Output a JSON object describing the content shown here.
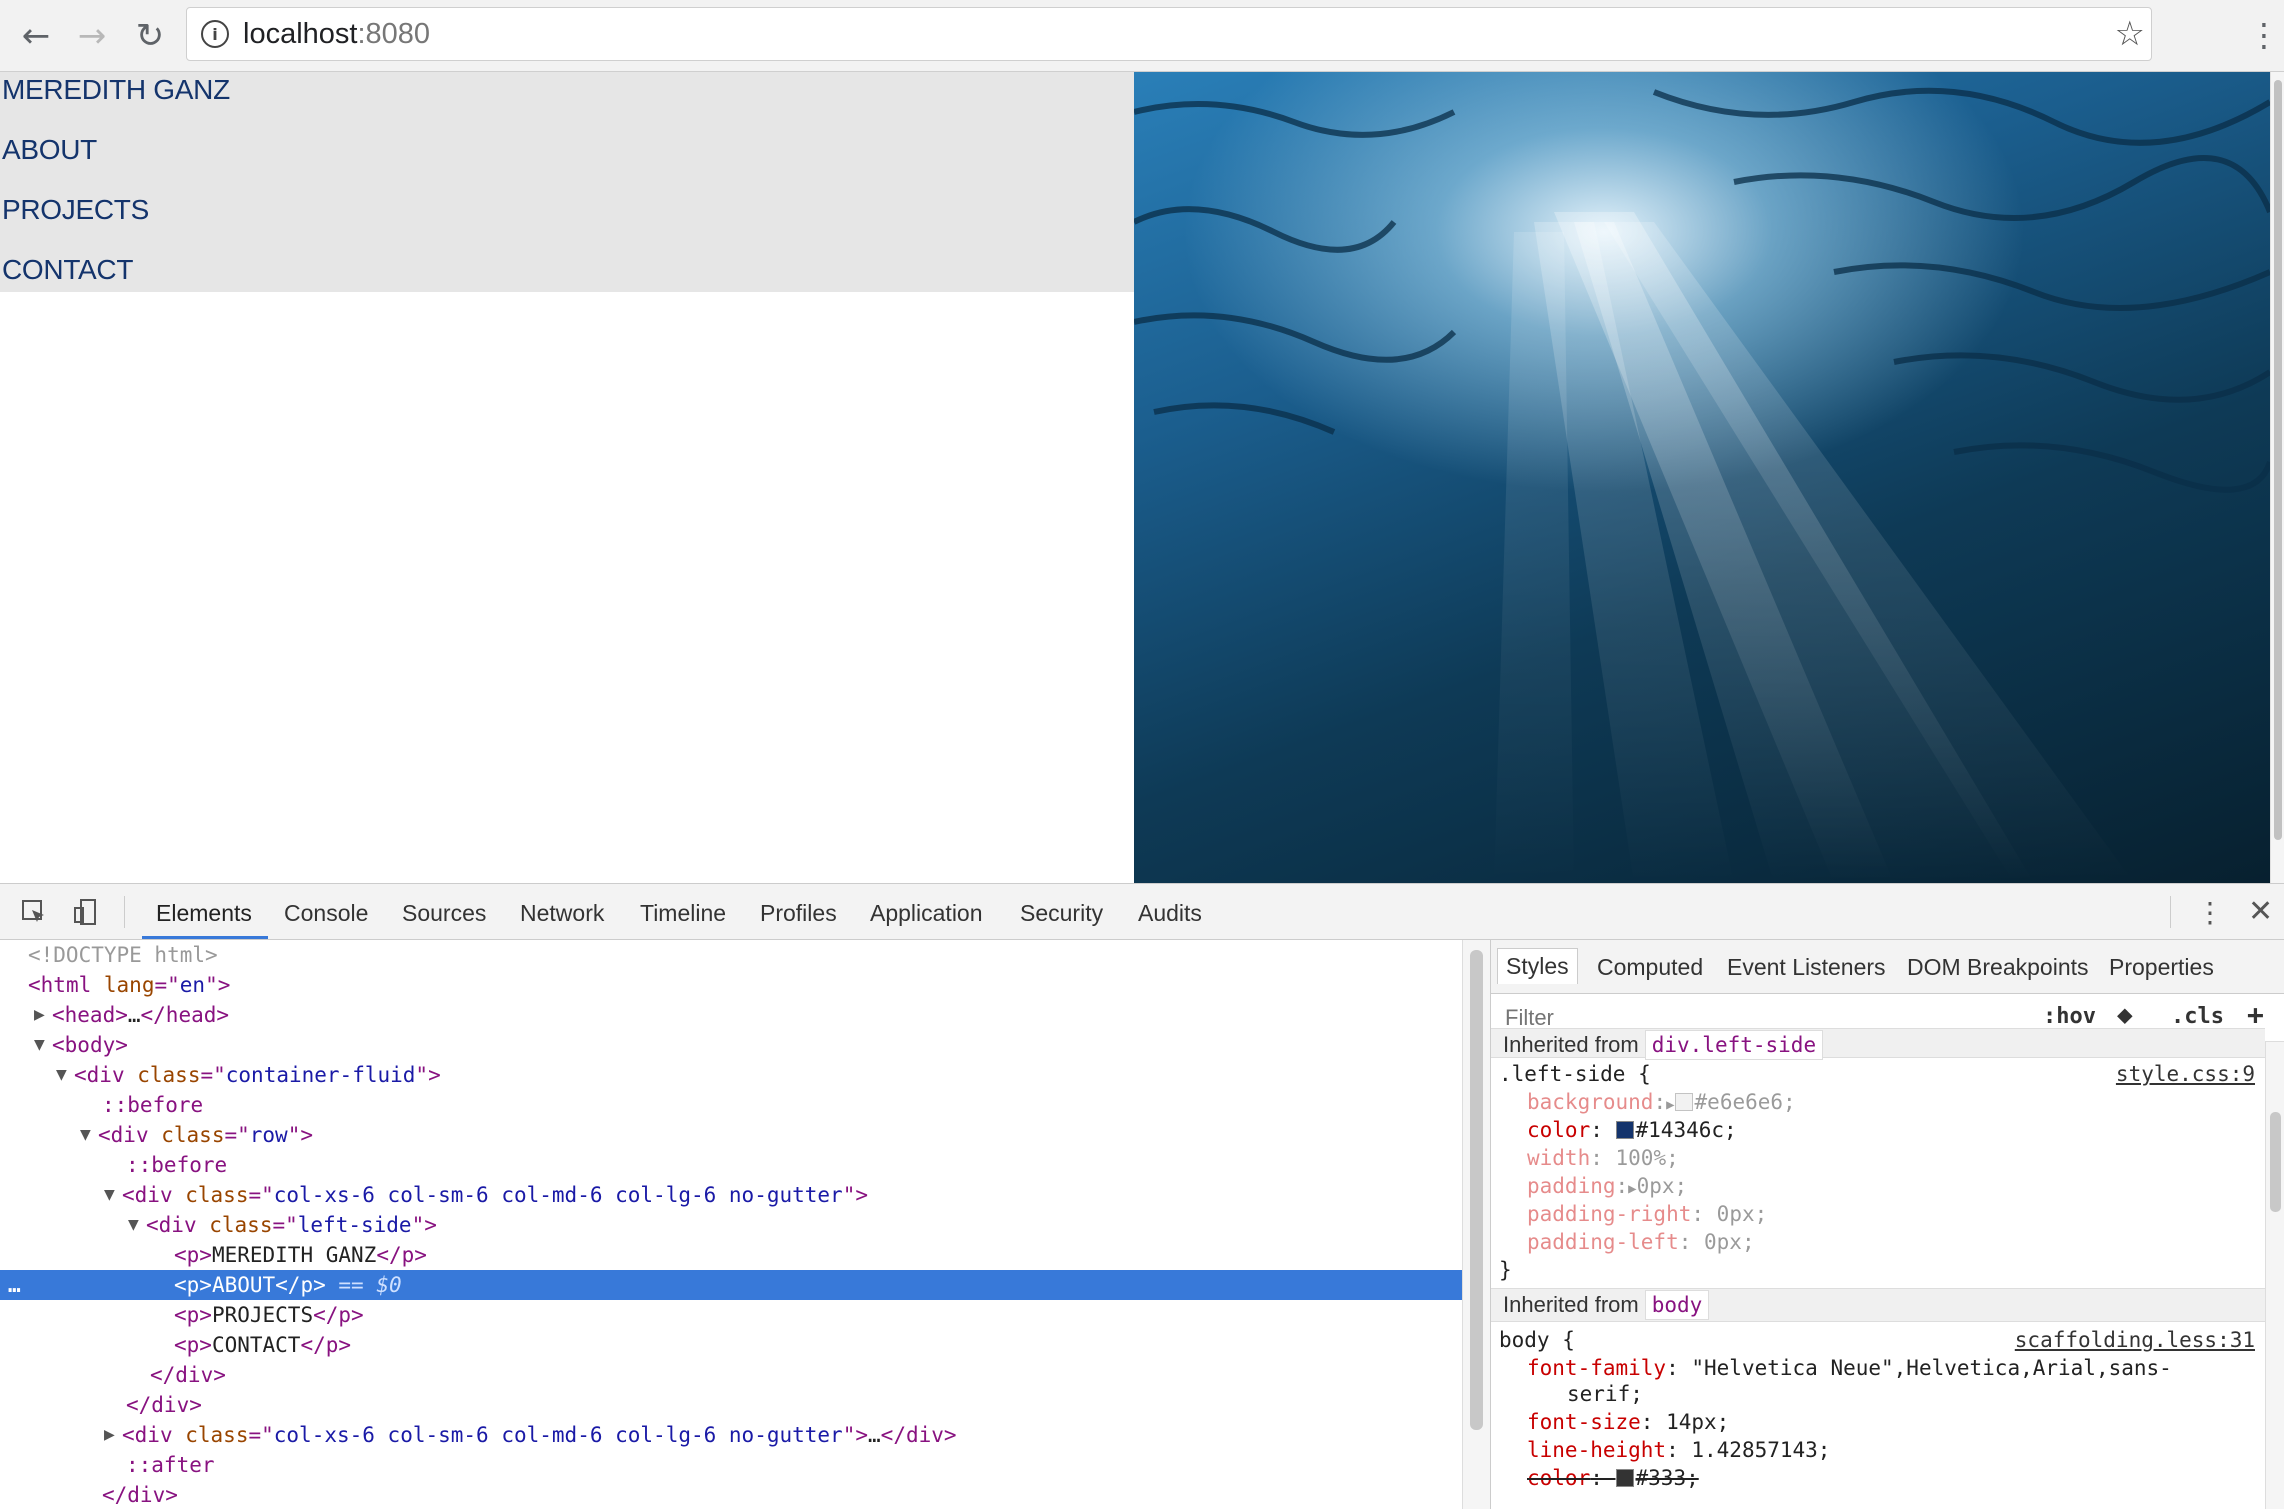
{
  "browser": {
    "url_host": "localhost",
    "url_port": ":8080",
    "icons": {
      "back": "back-arrow-icon",
      "forward": "forward-arrow-icon",
      "reload": "reload-icon",
      "info": "info-icon",
      "star": "star-icon",
      "menu": "kebab-menu-icon"
    }
  },
  "page": {
    "nav_items": [
      "MEREDITH GANZ",
      "ABOUT",
      "PROJECTS",
      "CONTACT"
    ],
    "left_background": "#e6e6e6",
    "link_color": "#14346c",
    "image_subject": "underwater sunlight rays"
  },
  "devtools": {
    "tabs": [
      "Elements",
      "Console",
      "Sources",
      "Network",
      "Timeline",
      "Profiles",
      "Application",
      "Security",
      "Audits"
    ],
    "active_tab": "Elements",
    "accent": "#3879d9",
    "dom": {
      "doctype": "<!DOCTYPE html>",
      "html_tag": "html",
      "lang_attr": "lang",
      "lang_val": "en",
      "head_collapsed": "…",
      "body": "body",
      "div": "div",
      "class_attr": "class",
      "container_class": "container-fluid",
      "row_class": "row",
      "col_class": "col-xs-6 col-sm-6 col-md-6 col-lg-6 no-gutter",
      "left_side_class": "left-side",
      "before": "::before",
      "after": "::after",
      "p_items": [
        "MEREDITH GANZ",
        "ABOUT",
        "PROJECTS",
        "CONTACT"
      ],
      "selected_marker": "== $0",
      "ellipsis": "…"
    },
    "styles_pane": {
      "tabs": [
        "Styles",
        "Computed",
        "Event Listeners",
        "DOM Breakpoints",
        "Properties"
      ],
      "filter_placeholder": "Filter",
      "hov": ":hov",
      "cls": ".cls",
      "plus": "+",
      "inherited_label": "Inherited from",
      "inherited_top_chip": "div.left-side",
      "rule1": {
        "selector": ".left-side {",
        "source": "style.css:9",
        "props": [
          {
            "name": "background",
            "value": "#e6e6e6",
            "active": false,
            "swatch": "#e6e6e6",
            "expand": true
          },
          {
            "name": "color",
            "value": "#14346c;",
            "active": true,
            "swatch": "#14346c",
            "expand": false
          },
          {
            "name": "width",
            "value": "100%;",
            "active": false
          },
          {
            "name": "padding",
            "value": "0px;",
            "active": false,
            "expand": true
          },
          {
            "name": "padding-right",
            "value": "0px;",
            "active": false
          },
          {
            "name": "padding-left",
            "value": "0px;",
            "active": false
          }
        ],
        "close": "}"
      },
      "inherited_body_chip": "body",
      "rule2": {
        "selector": "body {",
        "source": "scaffolding.less:31",
        "font_family_name": "font-family",
        "font_family_val": "\"Helvetica Neue\",Helvetica,Arial,sans-",
        "font_family_val2": "serif;",
        "font_size_name": "font-size",
        "font_size_val": "14px;",
        "line_height_name": "line-height",
        "line_height_val": "1.42857143;",
        "color_name": "color",
        "color_val": "#333;"
      }
    }
  }
}
